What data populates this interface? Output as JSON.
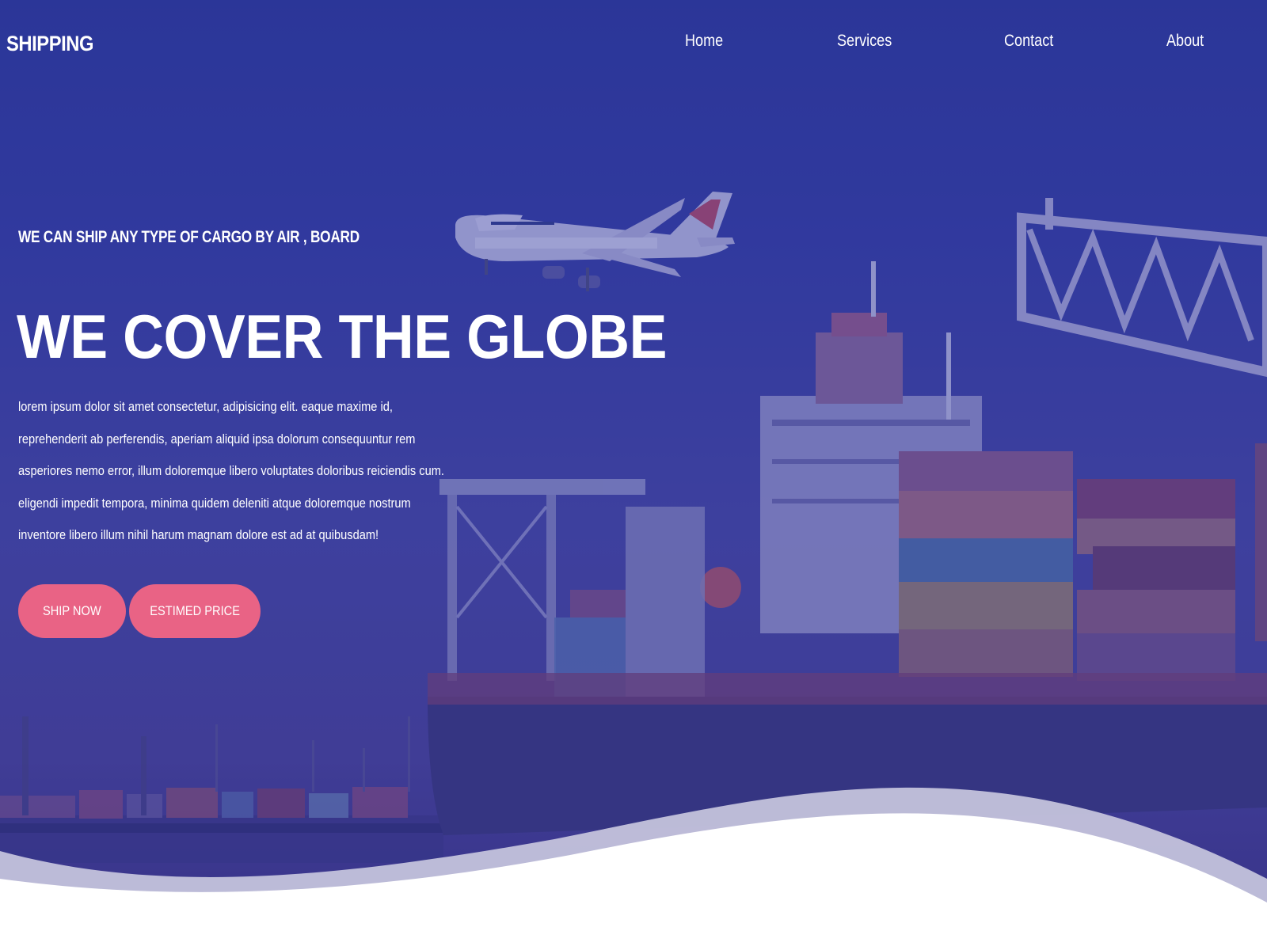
{
  "brand": {
    "logo": "SHIPPING"
  },
  "nav": {
    "items": [
      {
        "label": "Home"
      },
      {
        "label": "Services"
      },
      {
        "label": "Contact"
      },
      {
        "label": "About"
      }
    ]
  },
  "hero": {
    "subtitle": "WE CAN SHIP ANY TYPE OF CARGO BY AIR , BOARD",
    "headline": "WE COVER THE GLOBE",
    "body": "lorem ipsum dolor sit amet consectetur, adipisicing elit. eaque maxime id, reprehenderit ab perferendis, aperiam aliquid ipsa dolorum consequuntur rem asperiores nemo error, illum doloremque libero voluptates doloribus reiciendis cum. eligendi impedit tempora, minima quidem deleniti atque doloremque nostrum inventore libero illum nihil harum magnam dolore est ad at quibusdam!",
    "buttons": {
      "ship_now": "SHIP NOW",
      "estimated_price": "ESTIMED PRICE"
    }
  },
  "colors": {
    "overlay": "#2f3a9f",
    "accent_button": "#e96385",
    "text": "#ffffff"
  }
}
